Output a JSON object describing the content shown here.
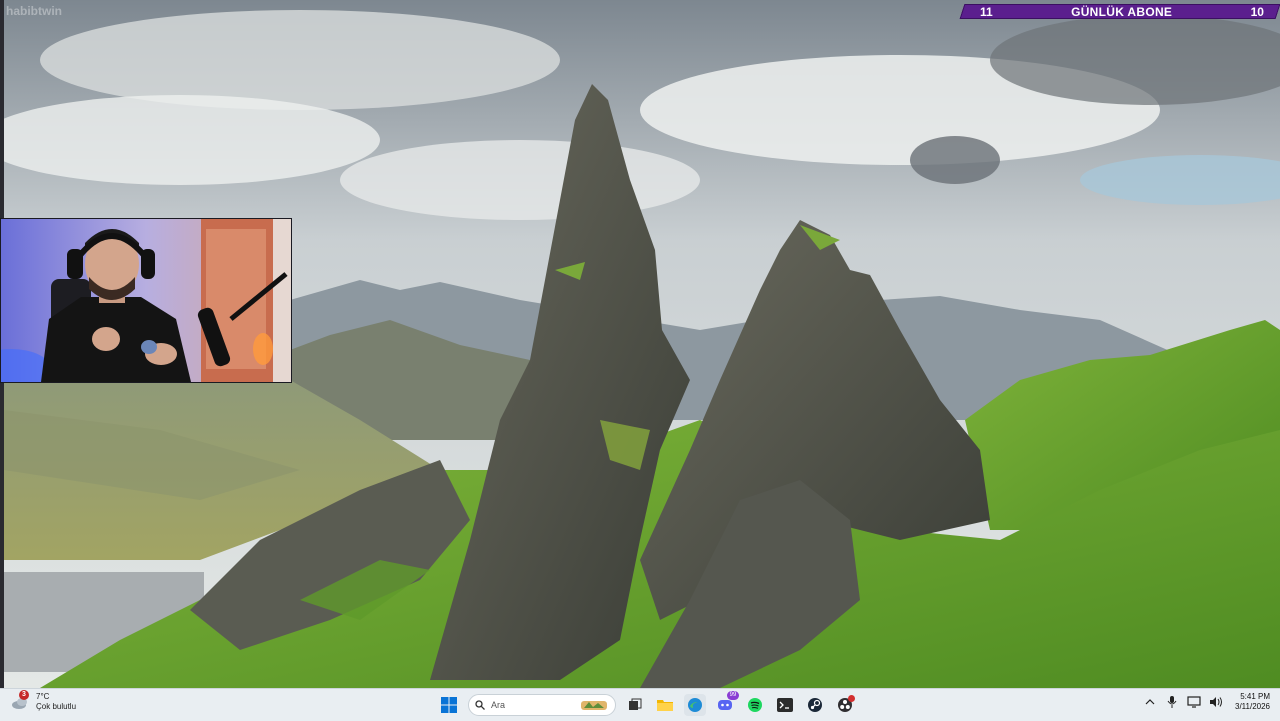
{
  "overlay": {
    "left_number": "11",
    "title": "GÜNLÜK ABONE",
    "right_number": "10",
    "watermark": "habibtwin"
  },
  "taskbar": {
    "weather": {
      "badge": "3",
      "temperature": "7°C",
      "condition": "Çok bulutlu"
    },
    "search": {
      "placeholder": "Ara"
    },
    "apps": [
      {
        "name": "start",
        "icon": "windows-icon"
      },
      {
        "name": "task-view",
        "icon": "task-view-icon"
      },
      {
        "name": "file-explorer",
        "icon": "folder-icon"
      },
      {
        "name": "edge",
        "icon": "edge-icon"
      },
      {
        "name": "discord",
        "icon": "discord-icon",
        "badge": "99"
      },
      {
        "name": "spotify",
        "icon": "spotify-icon"
      },
      {
        "name": "terminal",
        "icon": "terminal-icon"
      },
      {
        "name": "steam",
        "icon": "steam-icon"
      },
      {
        "name": "obs",
        "icon": "obs-icon"
      }
    ],
    "clock": {
      "time": "5:41 PM",
      "date": "3/11/2026"
    }
  },
  "colors": {
    "banner": "#5b1f8e",
    "taskbar": "#e9eef2",
    "grass": "#6aa82f",
    "rock": "#4d5048"
  }
}
